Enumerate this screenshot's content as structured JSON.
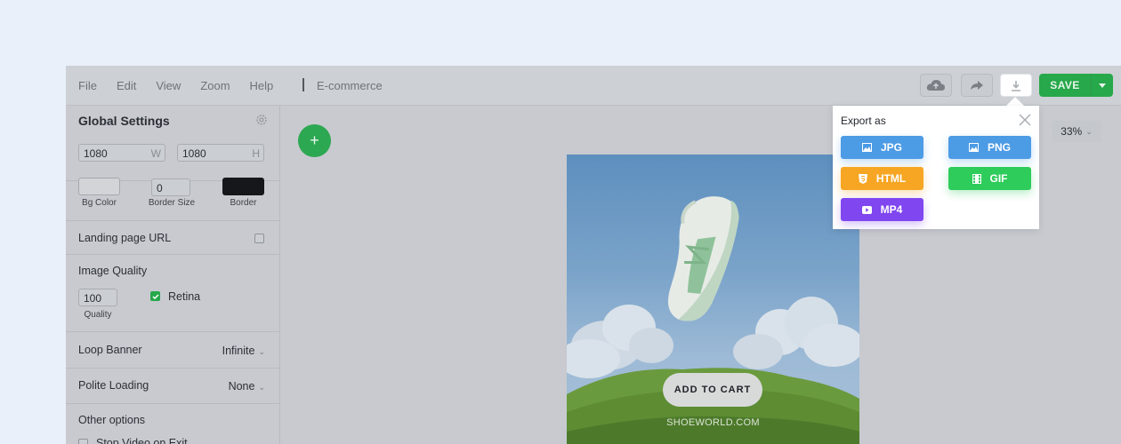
{
  "menu": [
    "File",
    "Edit",
    "View",
    "Zoom",
    "Help"
  ],
  "document_title": "E-commerce",
  "toolbar": {
    "save_label": "SAVE"
  },
  "global_settings": {
    "title": "Global Settings",
    "width": "1080",
    "width_suffix": "W",
    "height": "1080",
    "height_suffix": "H",
    "bg_color_label": "Bg Color",
    "border_size_value": "0",
    "border_size_label": "Border Size",
    "border_label": "Border",
    "bg_color": "#d2d4d8",
    "border_color": "#15171b"
  },
  "landing_page": {
    "label": "Landing page URL"
  },
  "image_quality": {
    "title": "Image Quality",
    "quality_value": "100",
    "quality_label": "Quality",
    "retina_label": "Retina",
    "retina_checked": true
  },
  "loop_banner": {
    "label": "Loop Banner",
    "value": "Infinite"
  },
  "polite_loading": {
    "label": "Polite Loading",
    "value": "None"
  },
  "other_options": {
    "label": "Other options",
    "stop_video_label": "Stop Video on Exit"
  },
  "canvas": {
    "zoom": "33%",
    "cta_label": "ADD TO CART",
    "site_label": "SHOEWORLD.COM"
  },
  "export": {
    "title": "Export as",
    "formats": [
      {
        "label": "JPG",
        "icon": "image-icon",
        "color": "#4c9be5"
      },
      {
        "label": "PNG",
        "icon": "image-icon",
        "color": "#4c9be5"
      },
      {
        "label": "HTML",
        "icon": "html5-icon",
        "color": "#f6a623"
      },
      {
        "label": "GIF",
        "icon": "film-icon",
        "color": "#2ecc5b"
      },
      {
        "label": "MP4",
        "icon": "video-icon",
        "color": "#8046f0"
      }
    ]
  }
}
